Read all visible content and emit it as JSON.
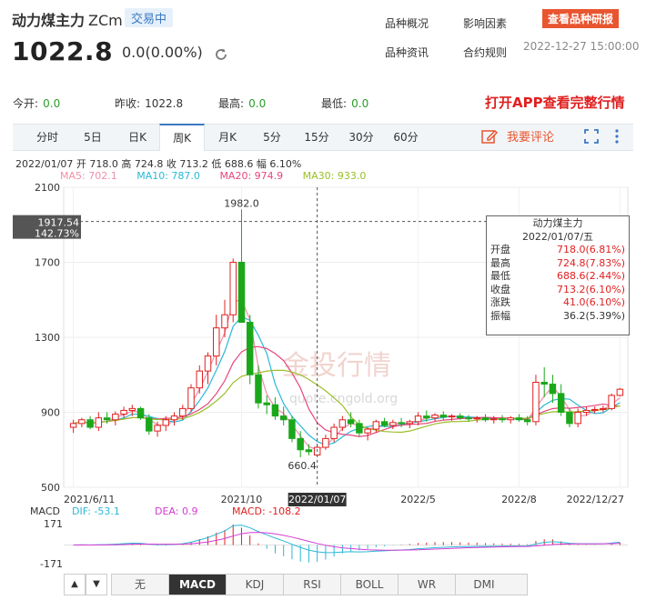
{
  "header": {
    "name": "动力煤主力",
    "code": "ZCm",
    "status": "交易中",
    "price": "1022.8",
    "change": "0.0(0.00%)",
    "links": [
      "品种概况",
      "影响因素",
      "品种资讯",
      "合约规则"
    ],
    "research_button": "查看品种研报",
    "timestamp": "2022-12-27 15:00:00"
  },
  "stats": {
    "open_label": "今开:",
    "open_value": "0.0",
    "prev_label": "昨收:",
    "prev_value": "1022.8",
    "high_label": "最高:",
    "high_value": "0.0",
    "low_label": "最低:",
    "low_value": "0.0",
    "app_link": "打开APP查看完整行情"
  },
  "tabs": [
    "分时",
    "5日",
    "日K",
    "周K",
    "月K",
    "5分",
    "15分",
    "30分",
    "60分"
  ],
  "active_tab": "周K",
  "comment_label": "我要评论",
  "info_line": "2022/01/07  开 718.0  高 724.8  收 713.2  低 688.6  幅 6.10%",
  "ma": [
    {
      "label": "MA5: 702.1",
      "color": "#f08fa8"
    },
    {
      "label": "MA10: 787.0",
      "color": "#2bb8d6"
    },
    {
      "label": "MA20: 974.9",
      "color": "#e8467e"
    },
    {
      "label": "MA30: 933.0",
      "color": "#9bbf2a"
    }
  ],
  "tooltip": {
    "title": "动力煤主力",
    "date": "2022/01/07/五",
    "rows": [
      {
        "k": "开盘",
        "v": "718.0(6.81%)"
      },
      {
        "k": "最高",
        "v": "724.8(7.83%)"
      },
      {
        "k": "最低",
        "v": "688.6(2.44%)"
      },
      {
        "k": "收盘",
        "v": "713.2(6.10%)"
      },
      {
        "k": "涨跌",
        "v": "41.0(6.10%)"
      },
      {
        "k": "振幅",
        "v": "36.2(5.39%)"
      }
    ]
  },
  "chart_data": {
    "type": "candlestick",
    "y_ticks": [
      "2100",
      "1700",
      "1300",
      "900",
      "500"
    ],
    "ylim": [
      500,
      2100
    ],
    "x_labels": [
      "2021/6/11",
      "2021/10",
      "2022/01/07",
      "2022/5",
      "2022/8",
      "2022/12/27"
    ],
    "crosshair_label": "1917.54",
    "crosshair_pct": "142.73%",
    "high_mark": "1982.0",
    "low_mark": "660.4",
    "watermark": "金投行情",
    "watermark_sub": "quote.cngold.org",
    "candles": [
      {
        "o": 820,
        "h": 860,
        "l": 790,
        "c": 840
      },
      {
        "o": 840,
        "h": 870,
        "l": 820,
        "c": 860
      },
      {
        "o": 860,
        "h": 880,
        "l": 810,
        "c": 820
      },
      {
        "o": 820,
        "h": 900,
        "l": 800,
        "c": 870
      },
      {
        "o": 870,
        "h": 900,
        "l": 840,
        "c": 860
      },
      {
        "o": 860,
        "h": 905,
        "l": 830,
        "c": 890
      },
      {
        "o": 890,
        "h": 930,
        "l": 870,
        "c": 910
      },
      {
        "o": 910,
        "h": 940,
        "l": 880,
        "c": 920
      },
      {
        "o": 920,
        "h": 930,
        "l": 860,
        "c": 870
      },
      {
        "o": 870,
        "h": 890,
        "l": 780,
        "c": 800
      },
      {
        "o": 800,
        "h": 850,
        "l": 770,
        "c": 830
      },
      {
        "o": 830,
        "h": 880,
        "l": 800,
        "c": 860
      },
      {
        "o": 860,
        "h": 900,
        "l": 830,
        "c": 880
      },
      {
        "o": 880,
        "h": 940,
        "l": 860,
        "c": 920
      },
      {
        "o": 920,
        "h": 1050,
        "l": 900,
        "c": 1030
      },
      {
        "o": 1030,
        "h": 1150,
        "l": 1000,
        "c": 1120
      },
      {
        "o": 1120,
        "h": 1220,
        "l": 1050,
        "c": 1200
      },
      {
        "o": 1200,
        "h": 1420,
        "l": 1150,
        "c": 1350
      },
      {
        "o": 1350,
        "h": 1500,
        "l": 1300,
        "c": 1420
      },
      {
        "o": 1420,
        "h": 1720,
        "l": 1380,
        "c": 1700
      },
      {
        "o": 1700,
        "h": 1982,
        "l": 1600,
        "c": 1380
      },
      {
        "o": 1380,
        "h": 1420,
        "l": 1050,
        "c": 1100
      },
      {
        "o": 1100,
        "h": 1150,
        "l": 920,
        "c": 950
      },
      {
        "o": 950,
        "h": 990,
        "l": 890,
        "c": 940
      },
      {
        "o": 940,
        "h": 980,
        "l": 860,
        "c": 880
      },
      {
        "o": 880,
        "h": 930,
        "l": 830,
        "c": 860
      },
      {
        "o": 860,
        "h": 880,
        "l": 740,
        "c": 760
      },
      {
        "o": 760,
        "h": 800,
        "l": 660,
        "c": 700
      },
      {
        "o": 700,
        "h": 730,
        "l": 670,
        "c": 690
      },
      {
        "o": 672,
        "h": 724,
        "l": 688,
        "c": 713
      },
      {
        "o": 713,
        "h": 780,
        "l": 700,
        "c": 760
      },
      {
        "o": 760,
        "h": 840,
        "l": 740,
        "c": 820
      },
      {
        "o": 820,
        "h": 880,
        "l": 800,
        "c": 860
      },
      {
        "o": 860,
        "h": 900,
        "l": 820,
        "c": 840
      },
      {
        "o": 840,
        "h": 860,
        "l": 770,
        "c": 790
      },
      {
        "o": 790,
        "h": 820,
        "l": 750,
        "c": 810
      },
      {
        "o": 810,
        "h": 860,
        "l": 790,
        "c": 850
      },
      {
        "o": 850,
        "h": 870,
        "l": 820,
        "c": 830
      },
      {
        "o": 830,
        "h": 860,
        "l": 810,
        "c": 845
      },
      {
        "o": 845,
        "h": 870,
        "l": 820,
        "c": 840
      },
      {
        "o": 840,
        "h": 860,
        "l": 815,
        "c": 850
      },
      {
        "o": 850,
        "h": 900,
        "l": 830,
        "c": 880
      },
      {
        "o": 880,
        "h": 910,
        "l": 850,
        "c": 870
      },
      {
        "o": 870,
        "h": 895,
        "l": 850,
        "c": 885
      },
      {
        "o": 885,
        "h": 905,
        "l": 860,
        "c": 875
      },
      {
        "o": 875,
        "h": 890,
        "l": 855,
        "c": 880
      },
      {
        "o": 880,
        "h": 895,
        "l": 860,
        "c": 870
      },
      {
        "o": 870,
        "h": 885,
        "l": 850,
        "c": 865
      },
      {
        "o": 865,
        "h": 880,
        "l": 845,
        "c": 870
      },
      {
        "o": 870,
        "h": 890,
        "l": 850,
        "c": 860
      },
      {
        "o": 860,
        "h": 880,
        "l": 840,
        "c": 865
      },
      {
        "o": 865,
        "h": 885,
        "l": 845,
        "c": 860
      },
      {
        "o": 860,
        "h": 880,
        "l": 840,
        "c": 870
      },
      {
        "o": 870,
        "h": 890,
        "l": 850,
        "c": 860
      },
      {
        "o": 860,
        "h": 880,
        "l": 830,
        "c": 850
      },
      {
        "o": 850,
        "h": 1100,
        "l": 830,
        "c": 1060
      },
      {
        "o": 1060,
        "h": 1140,
        "l": 980,
        "c": 1050
      },
      {
        "o": 1050,
        "h": 1100,
        "l": 950,
        "c": 1000
      },
      {
        "o": 1000,
        "h": 1050,
        "l": 880,
        "c": 900
      },
      {
        "o": 900,
        "h": 920,
        "l": 820,
        "c": 840
      },
      {
        "o": 840,
        "h": 920,
        "l": 820,
        "c": 900
      },
      {
        "o": 900,
        "h": 930,
        "l": 880,
        "c": 910
      },
      {
        "o": 910,
        "h": 930,
        "l": 895,
        "c": 915
      },
      {
        "o": 915,
        "h": 935,
        "l": 900,
        "c": 920
      },
      {
        "o": 920,
        "h": 1000,
        "l": 910,
        "c": 990
      },
      {
        "o": 990,
        "h": 1030,
        "l": 985,
        "c": 1022.8
      }
    ]
  },
  "macd": {
    "label": "MACD",
    "dif": "DIF: -53.1",
    "dea": "DEA: 0.9",
    "macd_val": "MACD: -108.2",
    "top_tick": "171",
    "bottom_tick": "-171",
    "colors": {
      "dif": "#2bb8d6",
      "dea": "#d63bd6",
      "up": "#e02020",
      "down": "#2bb8d6"
    }
  },
  "indicator_tabs": [
    "无",
    "MACD",
    "KDJ",
    "RSI",
    "BOLL",
    "WR",
    "DMI"
  ],
  "active_indicator": "MACD"
}
